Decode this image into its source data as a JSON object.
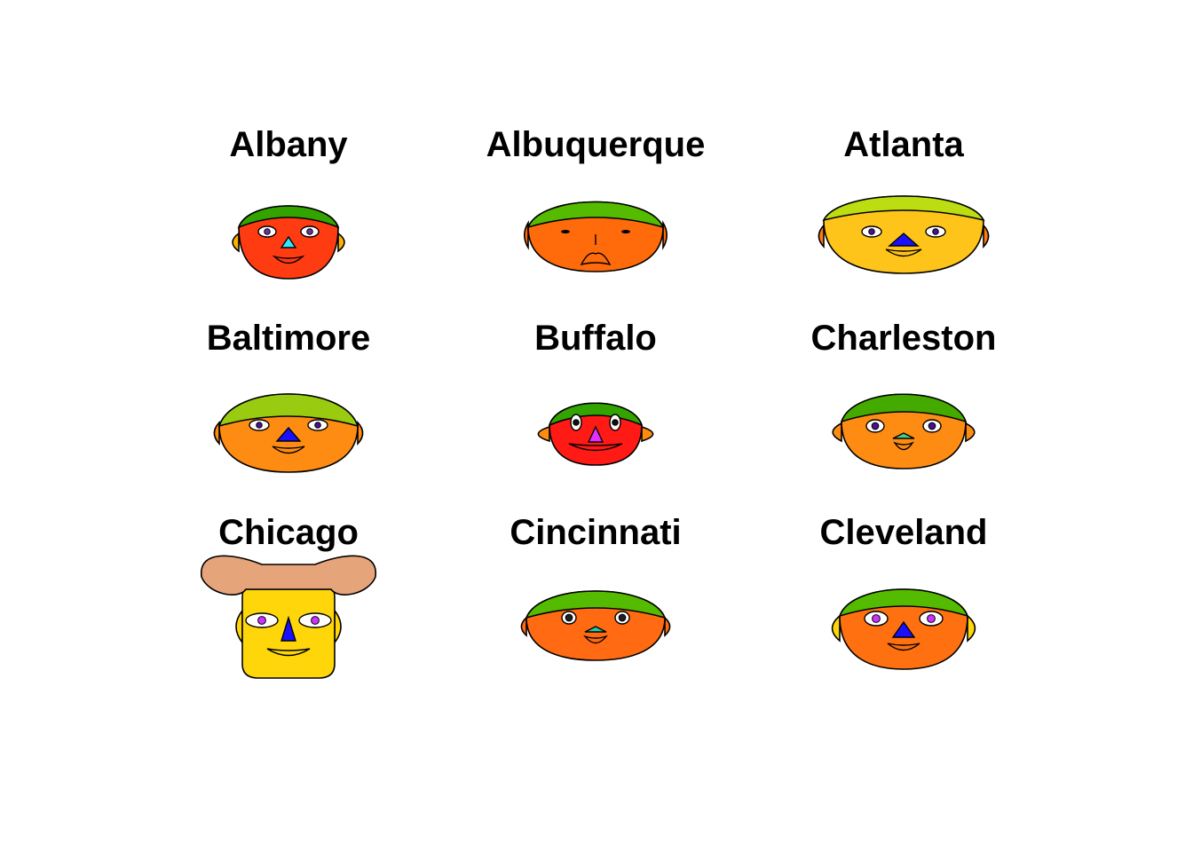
{
  "chart_data": {
    "type": "chernoff-faces",
    "title": "",
    "faces": [
      {
        "label": "Albany",
        "skin": "#ff3b12",
        "hair": "#33a300",
        "ear": "#ffb000",
        "nose_color": "#33e6ff",
        "iris": "#7030a0",
        "mouth": "smile"
      },
      {
        "label": "Albuquerque",
        "skin": "#ff6a0a",
        "hair": "#55bb00",
        "ear": "#ff6a0a",
        "nose_color": "#ff6a0a",
        "iris": "#000000",
        "mouth": "open"
      },
      {
        "label": "Atlanta",
        "skin": "#ffc41a",
        "hair": "#bbdd11",
        "ear": "#ff7a12",
        "nose_color": "#1a10ff",
        "iris": "#4a1090",
        "mouth": "smile"
      },
      {
        "label": "Baltimore",
        "skin": "#ff8c12",
        "hair": "#99cc11",
        "ear": "#ff8c12",
        "nose_color": "#1a10ff",
        "iris": "#4a1090",
        "mouth": "smile"
      },
      {
        "label": "Buffalo",
        "skin": "#ff1a16",
        "hair": "#33a300",
        "ear": "#ff8c12",
        "nose_color": "#e030ff",
        "iris": "#101010",
        "mouth": "smile"
      },
      {
        "label": "Charleston",
        "skin": "#ff8c12",
        "hair": "#44aa00",
        "ear": "#ff8c12",
        "nose_color": "#44cc88",
        "iris": "#4a1090",
        "mouth": "smile"
      },
      {
        "label": "Chicago",
        "skin": "#ffd60a",
        "hair": "#e6a47a",
        "ear": "#ffd60a",
        "nose_color": "#1a10ff",
        "iris": "#cc33ff",
        "mouth": "smile"
      },
      {
        "label": "Cincinnati",
        "skin": "#ff6a12",
        "hair": "#55bb00",
        "ear": "#ff6a12",
        "nose_color": "#22ccaa",
        "iris": "#202020",
        "mouth": "smile"
      },
      {
        "label": "Cleveland",
        "skin": "#ff7010",
        "hair": "#55bb00",
        "ear": "#ffd60a",
        "nose_color": "#1a10ff",
        "iris": "#cc33ff",
        "mouth": "smile"
      }
    ]
  }
}
